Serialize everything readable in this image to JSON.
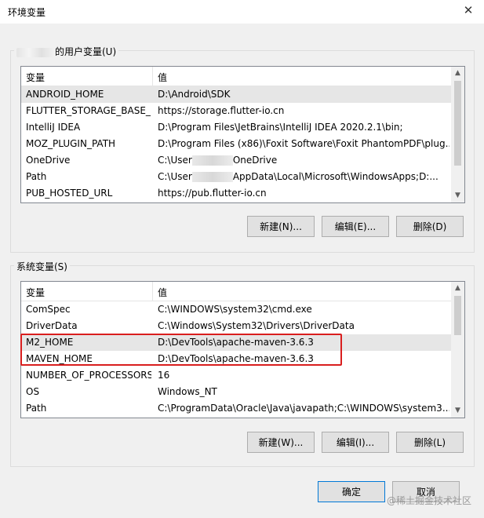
{
  "window": {
    "title": "环境变量",
    "close_icon": "close-icon"
  },
  "user_group": {
    "legend_suffix": "的用户变量(U)",
    "columns": {
      "name": "变量",
      "value": "值"
    },
    "rows": [
      {
        "name": "ANDROID_HOME",
        "value": "D:\\Android\\SDK"
      },
      {
        "name": "FLUTTER_STORAGE_BASE_...",
        "value": "https://storage.flutter-io.cn"
      },
      {
        "name": "IntelliJ IDEA",
        "value": "D:\\Program Files\\JetBrains\\IntelliJ IDEA 2020.2.1\\bin;"
      },
      {
        "name": "MOZ_PLUGIN_PATH",
        "value": "D:\\Program Files (x86)\\Foxit Software\\Foxit PhantomPDF\\plug..."
      },
      {
        "name": "OneDrive",
        "value_a": "C:\\User",
        "value_b": "OneDrive"
      },
      {
        "name": "Path",
        "value_a": "C:\\User",
        "value_b": "AppData\\Local\\Microsoft\\WindowsApps;D:..."
      },
      {
        "name": "PUB_HOSTED_URL",
        "value": "https://pub.flutter-io.cn"
      }
    ],
    "buttons": {
      "new": "新建(N)...",
      "edit": "编辑(E)...",
      "delete": "删除(D)"
    }
  },
  "system_group": {
    "legend": "系统变量(S)",
    "columns": {
      "name": "变量",
      "value": "值"
    },
    "rows": [
      {
        "name": "ComSpec",
        "value": "C:\\WINDOWS\\system32\\cmd.exe"
      },
      {
        "name": "DriverData",
        "value": "C:\\Windows\\System32\\Drivers\\DriverData"
      },
      {
        "name": "M2_HOME",
        "value": "D:\\DevTools\\apache-maven-3.6.3"
      },
      {
        "name": "MAVEN_HOME",
        "value": "D:\\DevTools\\apache-maven-3.6.3"
      },
      {
        "name": "NUMBER_OF_PROCESSORS",
        "value": "16"
      },
      {
        "name": "OS",
        "value": "Windows_NT"
      },
      {
        "name": "Path",
        "value": "C:\\ProgramData\\Oracle\\Java\\javapath;C:\\WINDOWS\\system3..."
      }
    ],
    "buttons": {
      "new": "新建(W)...",
      "edit": "编辑(I)...",
      "delete": "删除(L)"
    }
  },
  "footer": {
    "ok": "确定",
    "cancel": "取消"
  },
  "watermark": "@稀土掘金技术社区",
  "colors": {
    "highlight": "#d91e1e",
    "selected_row": "#e6e6e6"
  }
}
